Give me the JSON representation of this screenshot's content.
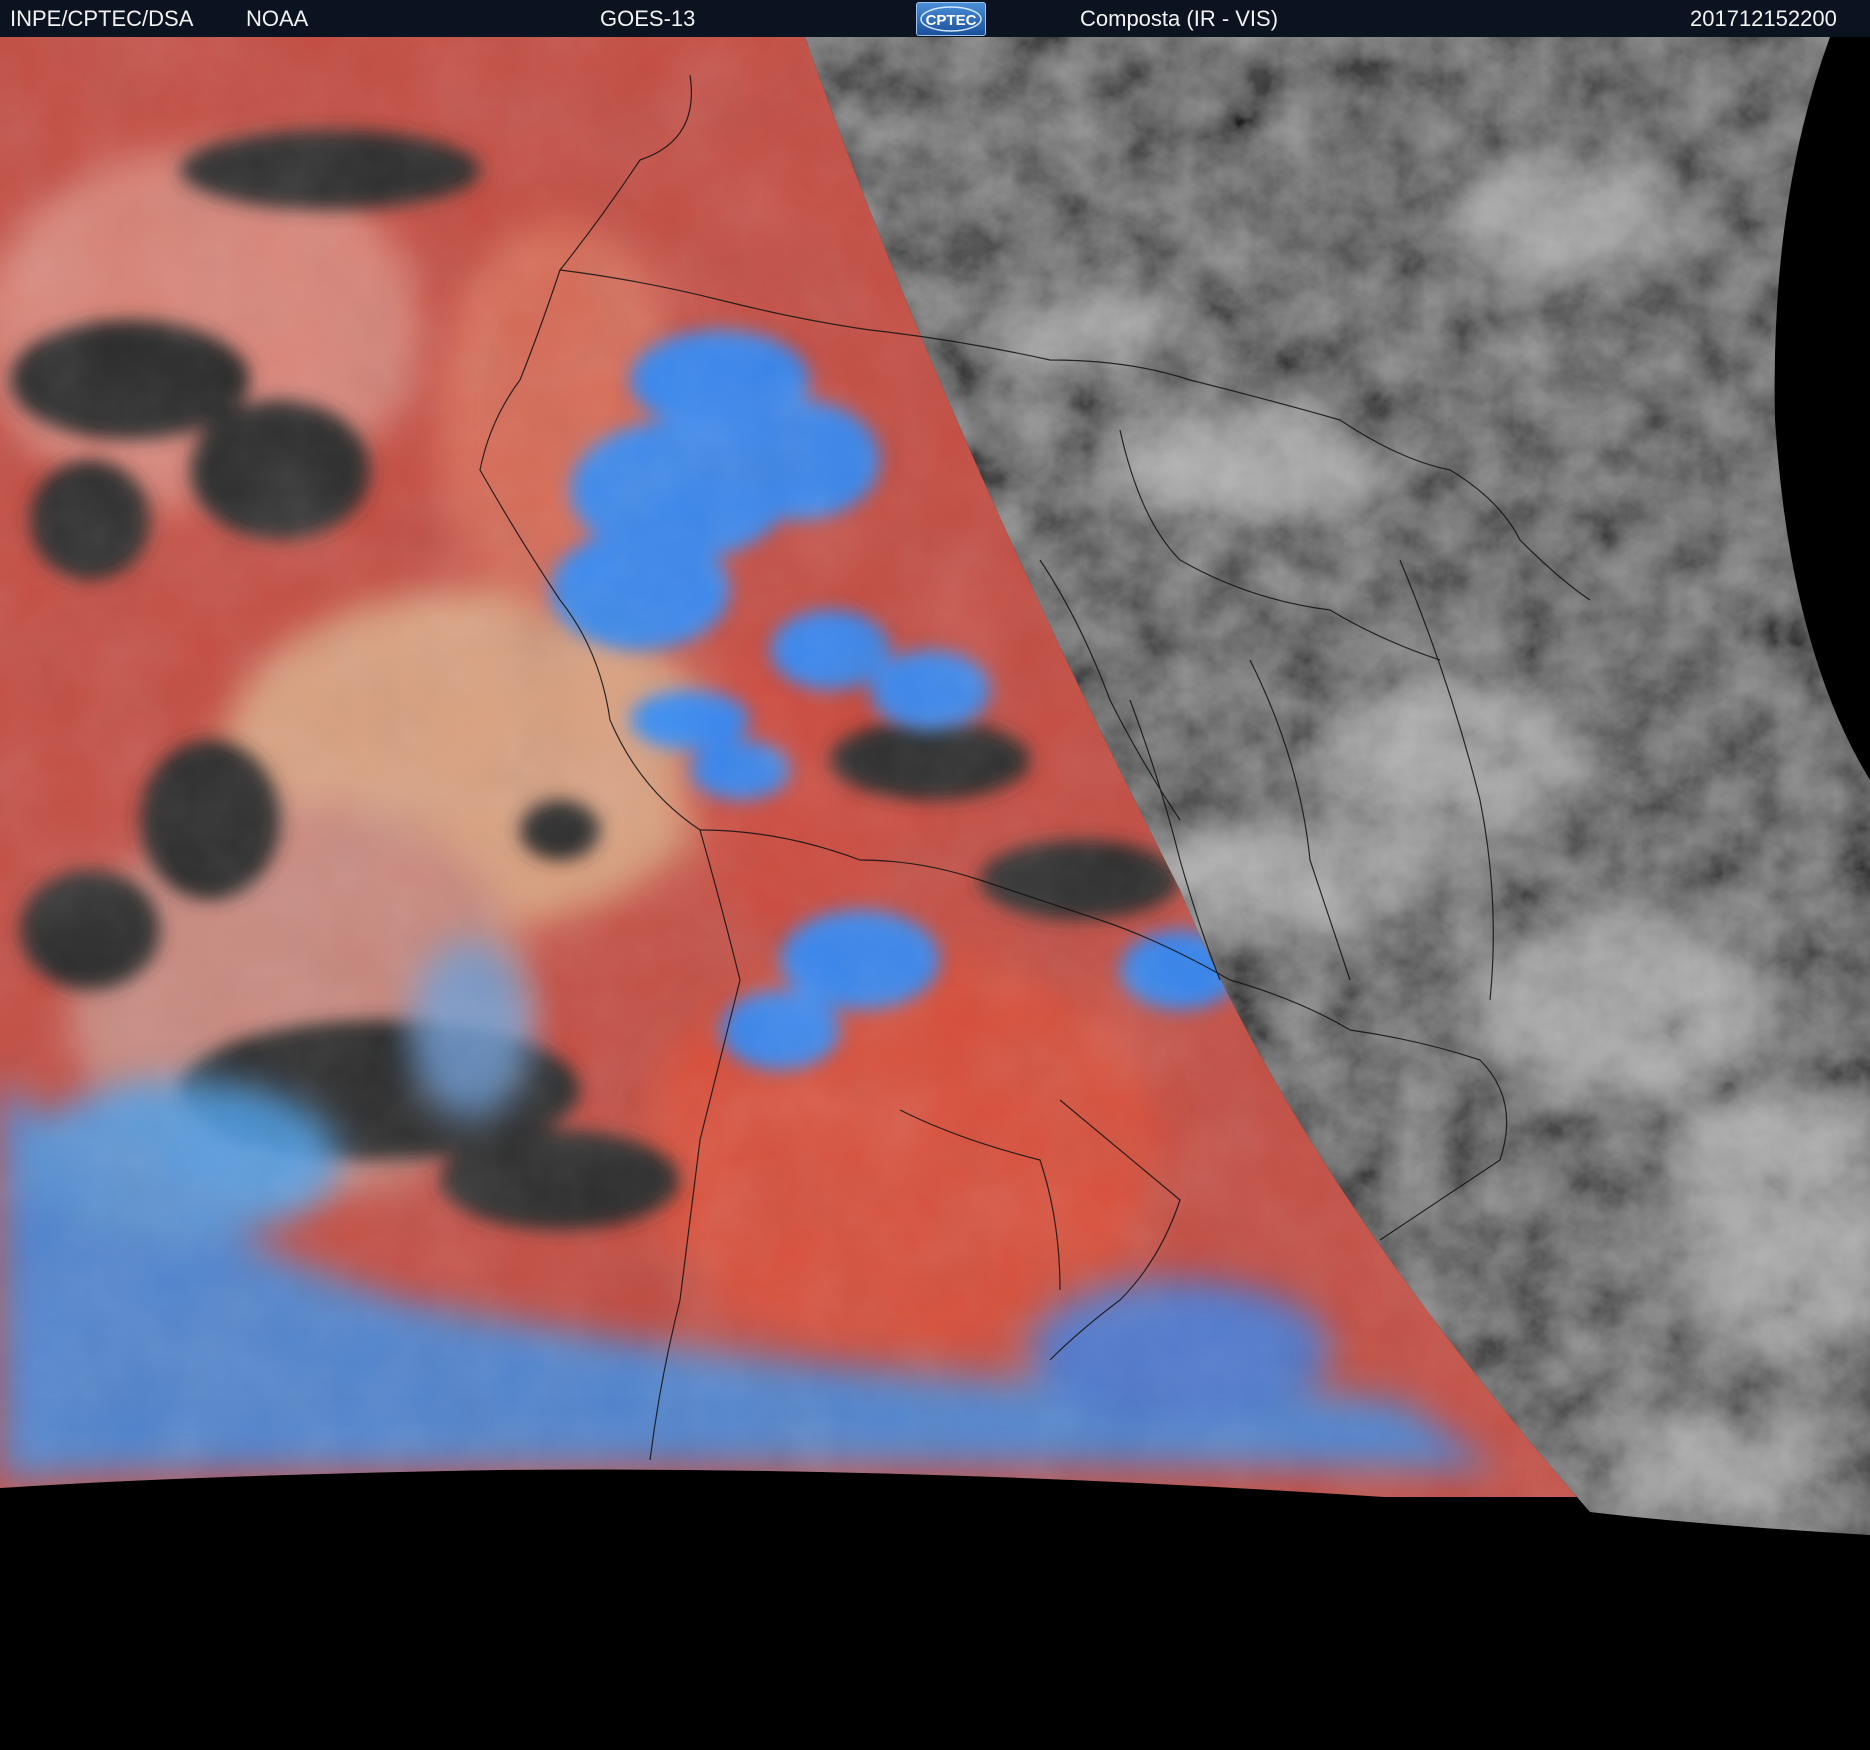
{
  "header": {
    "institution": "INPE/CPTEC/DSA",
    "agency": "NOAA",
    "satellite": "GOES-13",
    "logo_text": "CPTEC",
    "product": "Composta (IR - VIS)",
    "timestamp": "201712152200"
  },
  "map": {
    "background_color": "#000000",
    "ir_colors": [
      "#c8463a",
      "#d9826f",
      "#2f2f2f",
      "#2a8cff",
      "#9a6fb2"
    ],
    "vis_colors": [
      "#383838",
      "#5a5a5a",
      "#b9b9b9"
    ]
  }
}
